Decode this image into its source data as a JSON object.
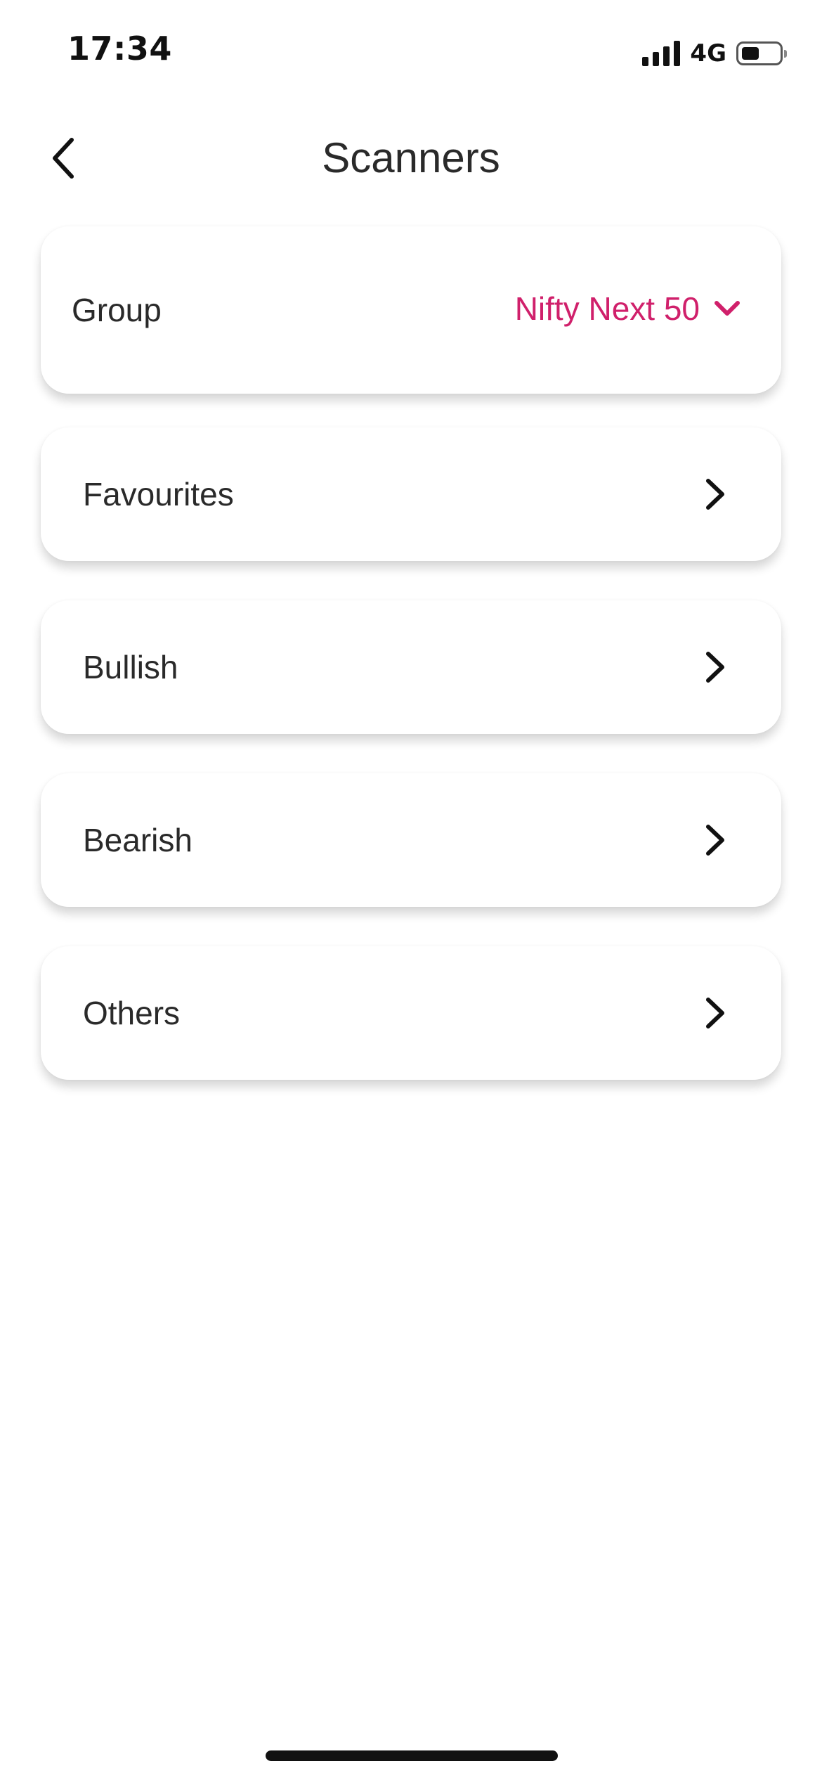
{
  "status_bar": {
    "time": "17:34",
    "network": "4G",
    "battery_level": 0.45
  },
  "header": {
    "title": "Scanners",
    "back_icon": "chevron-left-icon"
  },
  "group": {
    "label": "Group",
    "selected_value": "Nifty Next 50",
    "icon": "chevron-down-icon",
    "accent_color": "#d0206b"
  },
  "menu": {
    "items": [
      {
        "label": "Favourites",
        "icon": "chevron-right-icon"
      },
      {
        "label": "Bullish",
        "icon": "chevron-right-icon"
      },
      {
        "label": "Bearish",
        "icon": "chevron-right-icon"
      },
      {
        "label": "Others",
        "icon": "chevron-right-icon"
      }
    ]
  }
}
